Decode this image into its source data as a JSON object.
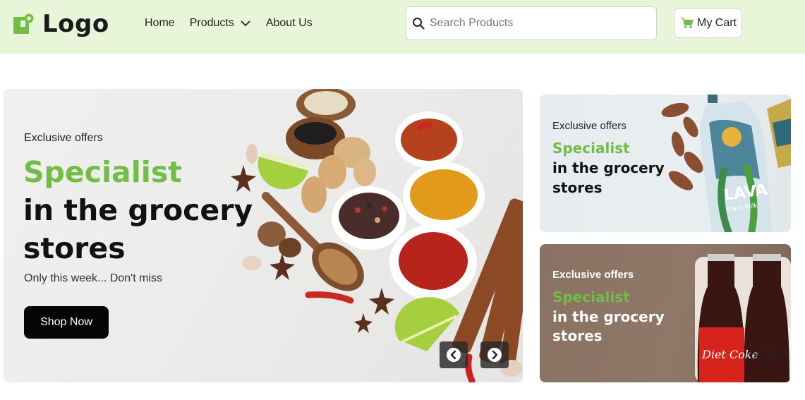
{
  "header": {
    "logo_text": "Logo",
    "nav": {
      "home": "Home",
      "products": "Products",
      "about": "About Us"
    },
    "search": {
      "placeholder": "Search Products",
      "value": ""
    },
    "cart_label": "My Cart"
  },
  "hero": {
    "eyebrow": "Exclusive offers",
    "title": "Specialist",
    "line1": "in the grocery",
    "line2": "stores",
    "note": "Only this week... Don't miss",
    "button": "Shop Now"
  },
  "cards": [
    {
      "eyebrow": "Exclusive offers",
      "title": "Specialist",
      "line1": "in the grocery",
      "line2": "stores",
      "product_text": [
        "LAVA",
        "Plant Milk"
      ]
    },
    {
      "eyebrow": "Exclusive offers",
      "title": "Specialist",
      "line1": "in the grocery",
      "line2": "stores",
      "product_text": [
        "Diet Coke",
        "NO SUGAR",
        "NO CALORIES"
      ]
    }
  ],
  "colors": {
    "header_bg": "#e9f5d9",
    "accent_green": "#71bd45",
    "button_dark": "#050505"
  },
  "icons": {
    "logo": "logo-mark-icon",
    "products_dropdown": "chevron-down-icon",
    "search": "search-icon",
    "cart": "cart-icon",
    "carousel_prev": "chevron-left-icon",
    "carousel_next": "chevron-right-icon"
  }
}
